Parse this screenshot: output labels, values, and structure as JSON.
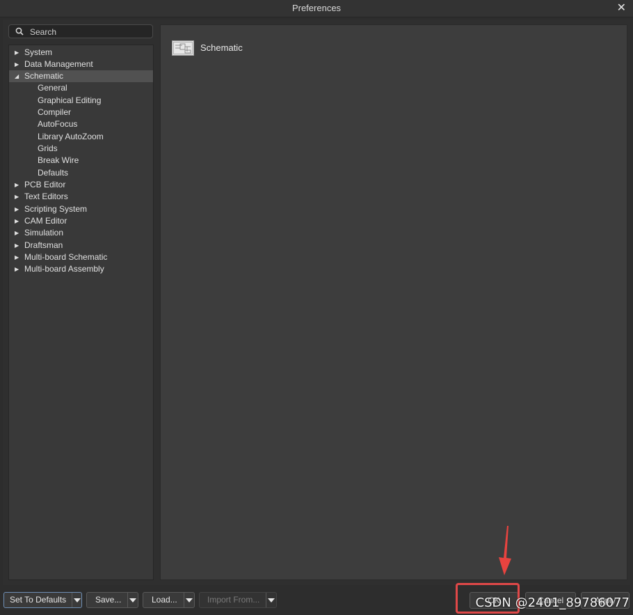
{
  "window": {
    "title": "Preferences",
    "close_glyph": "✕"
  },
  "search": {
    "placeholder": "Search",
    "icon": "search-icon"
  },
  "tree": [
    {
      "label": "System",
      "expandable": true,
      "expanded": false,
      "level": 0
    },
    {
      "label": "Data Management",
      "expandable": true,
      "expanded": false,
      "level": 0
    },
    {
      "label": "Schematic",
      "expandable": true,
      "expanded": true,
      "level": 0,
      "selected": true
    },
    {
      "label": "General",
      "level": 1
    },
    {
      "label": "Graphical Editing",
      "level": 1
    },
    {
      "label": "Compiler",
      "level": 1
    },
    {
      "label": "AutoFocus",
      "level": 1
    },
    {
      "label": "Library AutoZoom",
      "level": 1
    },
    {
      "label": "Grids",
      "level": 1
    },
    {
      "label": "Break Wire",
      "level": 1
    },
    {
      "label": "Defaults",
      "level": 1
    },
    {
      "label": "PCB Editor",
      "expandable": true,
      "expanded": false,
      "level": 0
    },
    {
      "label": "Text Editors",
      "expandable": true,
      "expanded": false,
      "level": 0
    },
    {
      "label": "Scripting System",
      "expandable": true,
      "expanded": false,
      "level": 0
    },
    {
      "label": "CAM Editor",
      "expandable": true,
      "expanded": false,
      "level": 0
    },
    {
      "label": "Simulation",
      "expandable": true,
      "expanded": false,
      "level": 0
    },
    {
      "label": "Draftsman",
      "expandable": true,
      "expanded": false,
      "level": 0
    },
    {
      "label": "Multi-board Schematic",
      "expandable": true,
      "expanded": false,
      "level": 0
    },
    {
      "label": "Multi-board Assembly",
      "expandable": true,
      "expanded": false,
      "level": 0
    }
  ],
  "content": {
    "title": "Schematic",
    "icon": "schematic-page-icon"
  },
  "footer": {
    "set_defaults": "Set To Defaults",
    "save": "Save...",
    "load": "Load...",
    "import_from": "Import From...",
    "ok": "OK",
    "cancel": "Cancel",
    "apply": "Apply"
  },
  "watermark": "CSDN @2401_89786077",
  "colors": {
    "annotation_red": "#e04848",
    "selected_row": "#515151",
    "background": "#2d2d2d"
  }
}
